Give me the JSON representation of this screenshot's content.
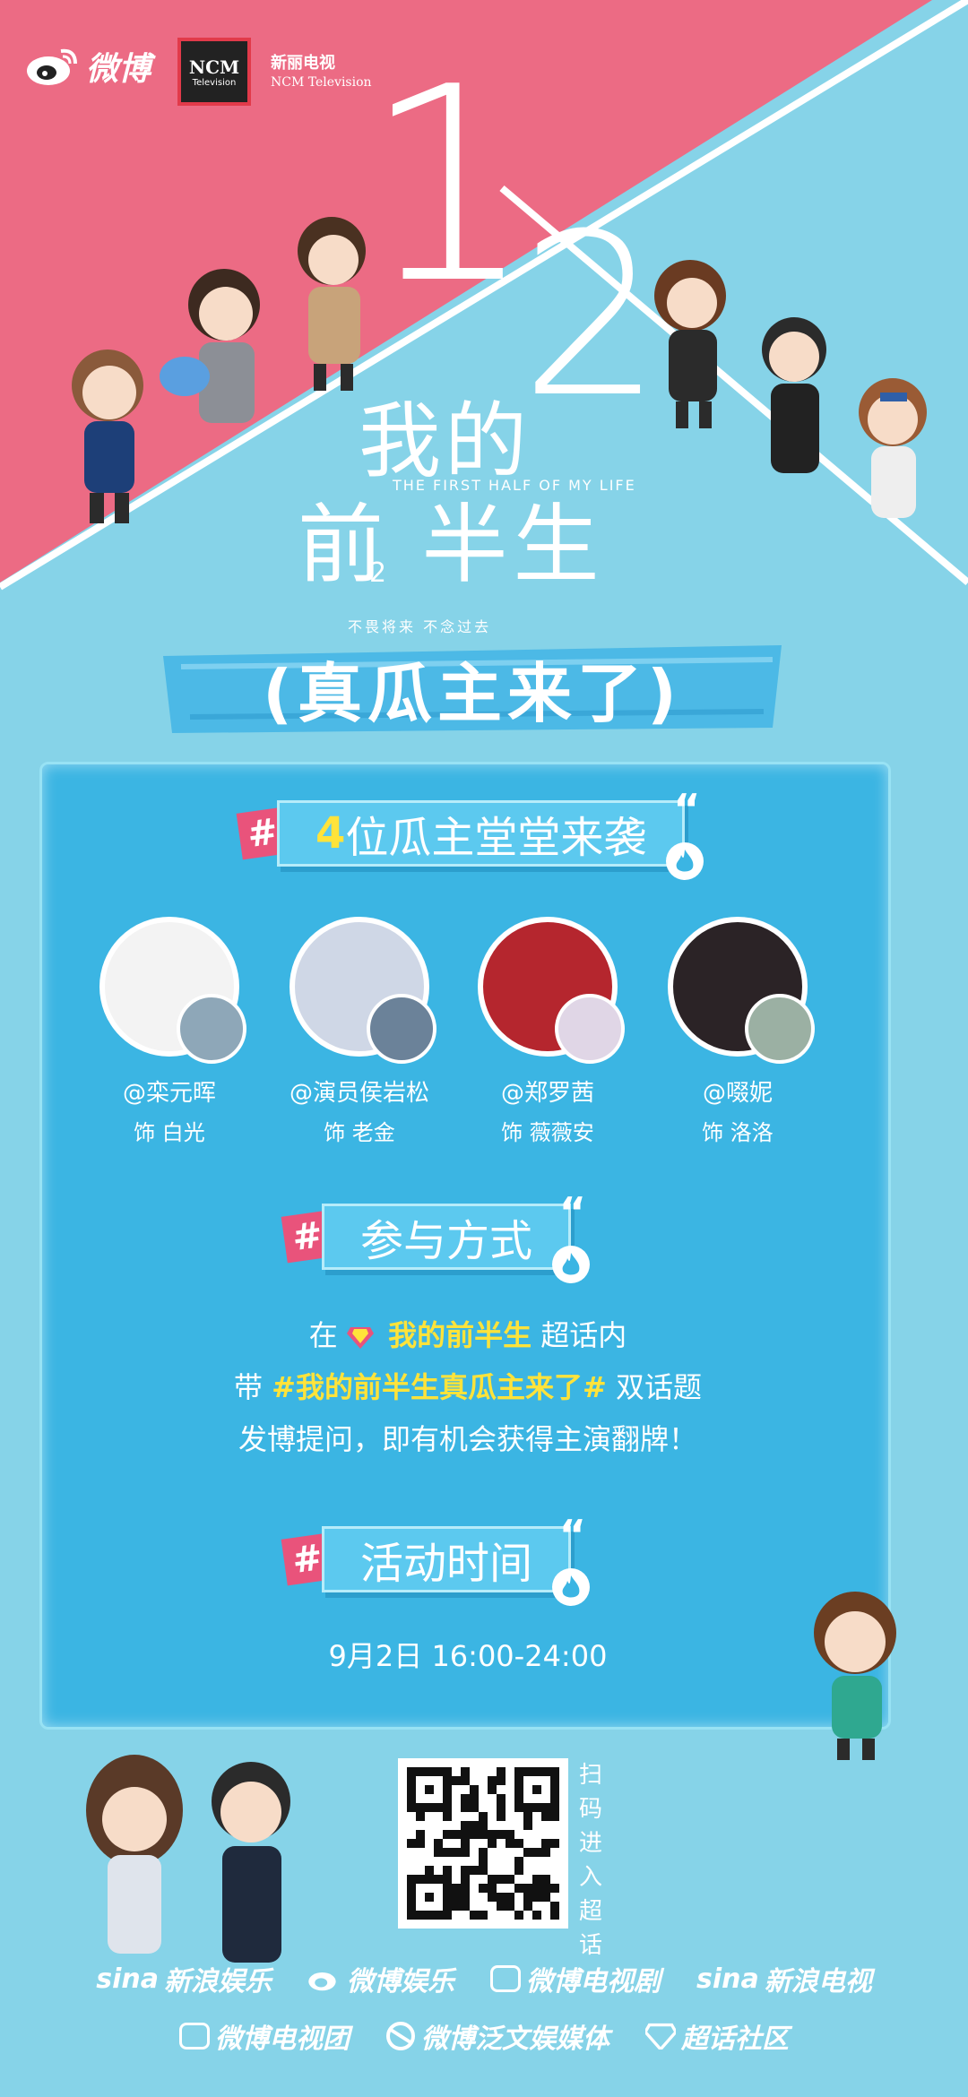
{
  "header": {
    "weibo_text": "微博",
    "ncm_main": "NCM",
    "ncm_sub": "Television",
    "ncm_cn": "新丽电视",
    "ncm_en": "NCM Television"
  },
  "hero": {
    "num1": "1",
    "num2": "2",
    "title_line1": "我的",
    "title_line2": "前 半生",
    "title_sup": "2",
    "title_en": "THE FIRST HALF OF MY LIFE",
    "slogan": "不畏将来  不念过去",
    "banner": "(真瓜主来了)"
  },
  "section_guests": {
    "hash": "#",
    "count": "4",
    "label": "位瓜主堂堂来袭",
    "quote": "“"
  },
  "guests": [
    {
      "name": "@栾元晖",
      "role": "饰 白光",
      "color": "#f3f3f3",
      "small_color": "#8ea7b8"
    },
    {
      "name": "@演员侯岩松",
      "role": "饰 老金",
      "color": "#cfd7e6",
      "small_color": "#6b8299"
    },
    {
      "name": "@郑罗茜",
      "role": "饰 薇薇安",
      "color": "#b5262e",
      "small_color": "#e0d6e6"
    },
    {
      "name": "@啜妮",
      "role": "饰 洛洛",
      "color": "#2b2326",
      "small_color": "#9bb0a3"
    }
  ],
  "section_join": {
    "hash": "#",
    "label": "参与方式",
    "quote": "“"
  },
  "join_lines": {
    "l1_pre": "在 ",
    "l1_hl": "我的前半生",
    "l1_post": " 超话内",
    "l2_pre": "带 ",
    "l2_hl": "#我的前半生真瓜主来了#",
    "l2_post": " 双话题",
    "l3": "发博提问，即有机会获得主演翻牌！"
  },
  "section_time": {
    "hash": "#",
    "label": "活动时间",
    "quote": "“",
    "time": "9月2日 16:00-24:00"
  },
  "qr": {
    "label": "扫码进入超话"
  },
  "sponsors_row1": [
    "新浪娱乐",
    "微博娱乐",
    "微博电视剧",
    "新浪电视"
  ],
  "sponsors_row1_prefix": [
    "sina",
    "",
    "",
    "sina"
  ],
  "sponsors_row2": [
    "微博电视团",
    "微博泛文娱媒体",
    "超话社区"
  ],
  "colors": {
    "pink": "#ec6b84",
    "sky": "#86d3e8",
    "panel": "#3bb5e3",
    "accent_yellow": "#ffe33a",
    "hash_pink": "#e9537b"
  },
  "icons": [
    "weibo-logo-icon",
    "ncm-logo-icon",
    "flame-icon",
    "gem-icon",
    "qr-code-icon",
    "tv-icon"
  ]
}
